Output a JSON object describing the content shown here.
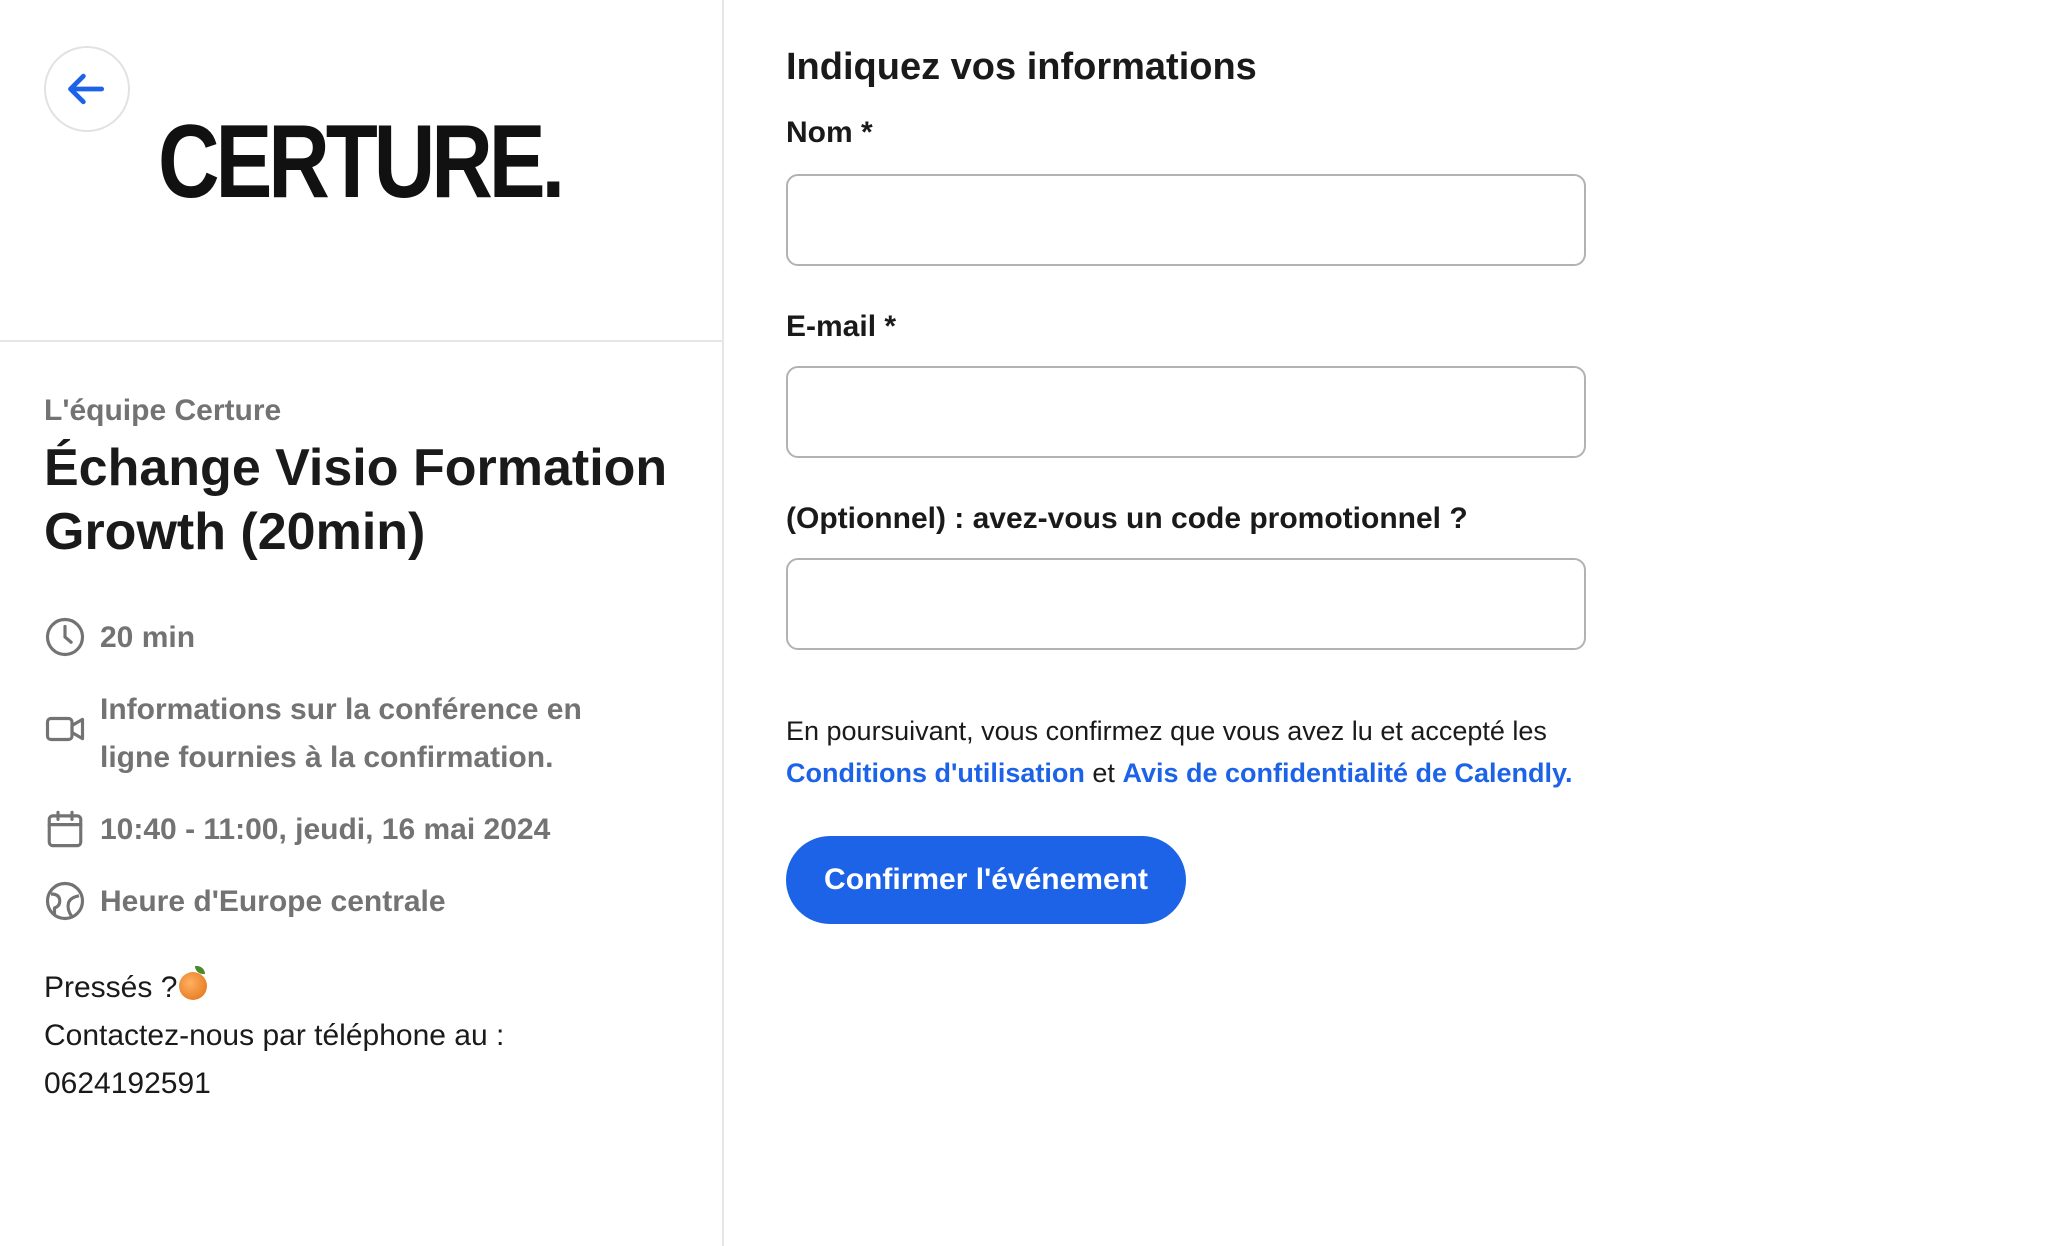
{
  "brand": {
    "logo_text": "CERTURE.",
    "accent_color": "#1d63e8"
  },
  "back_button": {
    "icon": "arrow-left-icon"
  },
  "event": {
    "organizer": "L'équipe Certure",
    "title": "Échange Visio Formation Growth (20min)",
    "duration": "20 min",
    "conference_info": "Informations sur la conférence en ligne fournies à la confirmation.",
    "datetime": "10:40 - 11:00, jeudi, 16 mai 2024",
    "timezone": "Heure d'Europe centrale"
  },
  "note": {
    "line1": "Pressés ?",
    "line2": "Contactez-nous par téléphone au :",
    "phone": "0624192591"
  },
  "form": {
    "heading": "Indiquez vos informations",
    "name_label": "Nom *",
    "name_value": "",
    "email_label": "E-mail *",
    "email_value": "",
    "promo_label": "(Optionnel) : avez-vous un code promotionnel ?",
    "promo_value": ""
  },
  "consent": {
    "text_before": "En poursuivant, vous confirmez que vous avez lu et accepté les",
    "terms_link": "Conditions d'utilisation",
    "conjunction": "et",
    "privacy_link": "Avis de confidentialité de Calendly."
  },
  "confirm_button_label": "Confirmer l'événement"
}
